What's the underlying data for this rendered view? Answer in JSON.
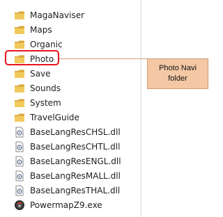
{
  "items": [
    {
      "label": "MagaNaviser",
      "icon": "folder-icon"
    },
    {
      "label": "Maps",
      "icon": "folder-icon"
    },
    {
      "label": "Organic",
      "icon": "folder-icon"
    },
    {
      "label": "Photo",
      "icon": "folder-icon"
    },
    {
      "label": "Save",
      "icon": "folder-icon"
    },
    {
      "label": "Sounds",
      "icon": "folder-icon"
    },
    {
      "label": "System",
      "icon": "folder-icon"
    },
    {
      "label": "TravelGuide",
      "icon": "folder-icon"
    },
    {
      "label": "BaseLangResCHSL.dll",
      "icon": "dll-file-icon"
    },
    {
      "label": "BaseLangResCHTL.dll",
      "icon": "dll-file-icon"
    },
    {
      "label": "BaseLangResENGL.dll",
      "icon": "dll-file-icon"
    },
    {
      "label": "BaseLangResMALL.dll",
      "icon": "dll-file-icon"
    },
    {
      "label": "BaseLangResTHAL.dll",
      "icon": "dll-file-icon"
    },
    {
      "label": "PowermapZ9.exe",
      "icon": "exe-file-icon"
    }
  ],
  "callout": {
    "line1": "Photo Navi",
    "line2": "folder"
  },
  "colors": {
    "highlight": "#e8131b",
    "callout_fill": "#f4c8a4",
    "callout_border": "#cf9a76",
    "folder": "#e9b84a"
  }
}
